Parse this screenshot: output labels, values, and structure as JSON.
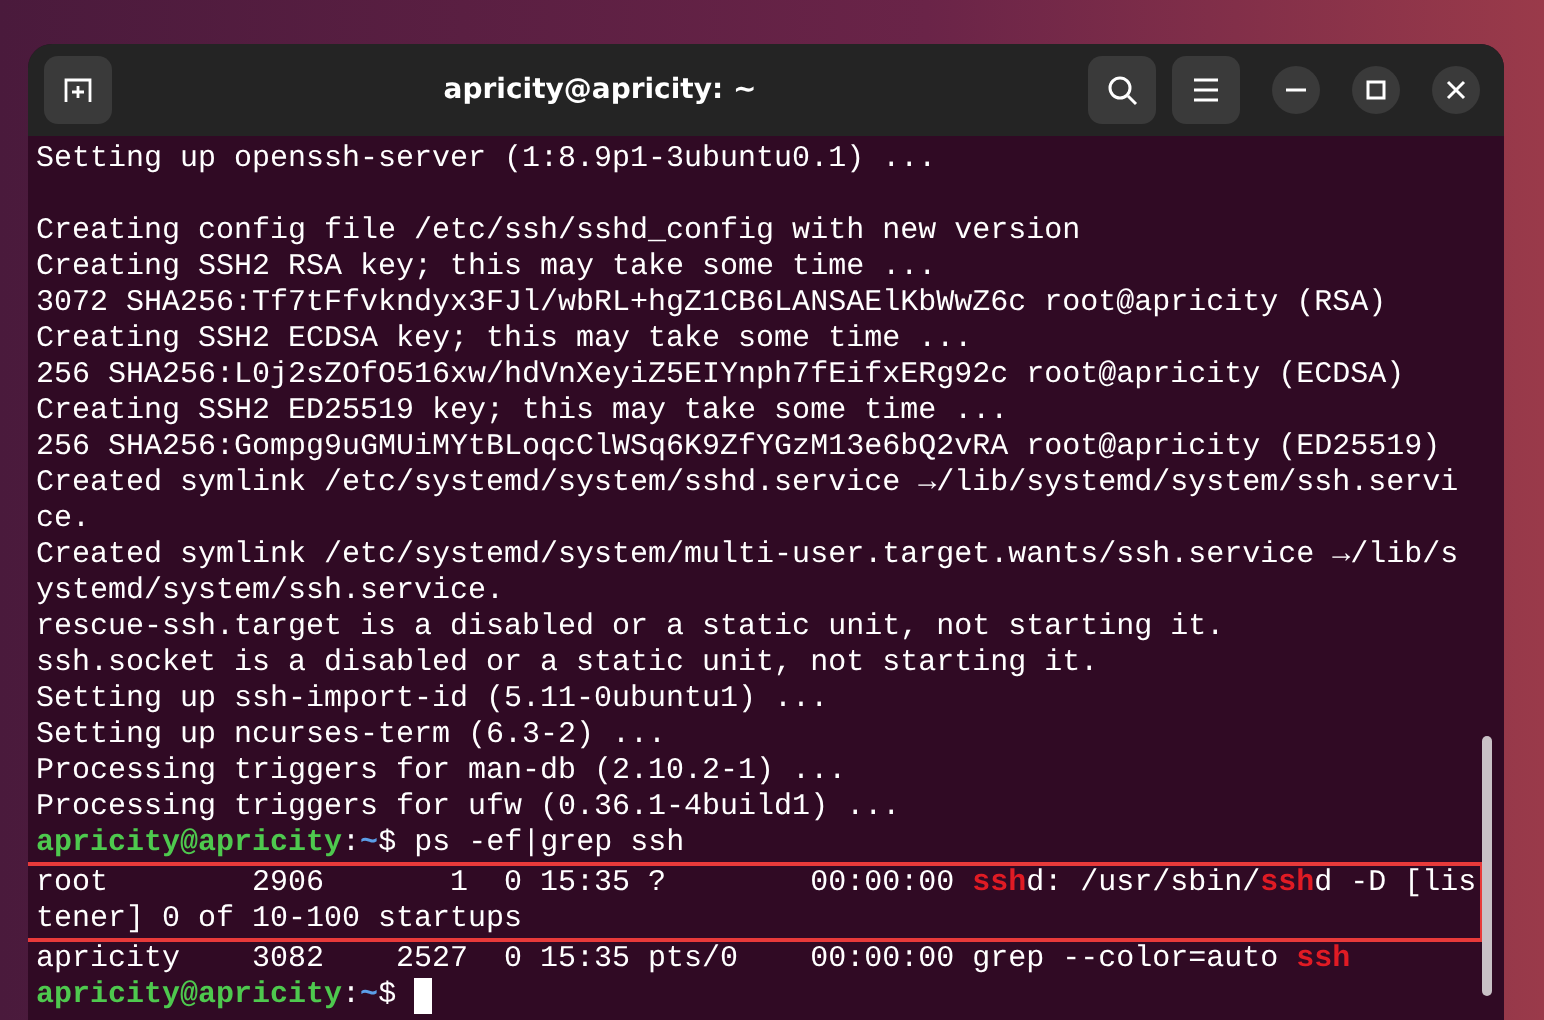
{
  "window": {
    "title": "apricity@apricity: ~"
  },
  "terminal": {
    "lines": [
      {
        "kind": "output",
        "highlighted": false,
        "segments": [
          {
            "kind": "plain",
            "text": "Setting up openssh-server (1:8.9p1-3ubuntu0.1) ..."
          }
        ]
      },
      {
        "kind": "blank",
        "highlighted": false
      },
      {
        "kind": "output",
        "highlighted": false,
        "segments": [
          {
            "kind": "plain",
            "text": "Creating config file /etc/ssh/sshd_config with new version"
          }
        ]
      },
      {
        "kind": "output",
        "highlighted": false,
        "segments": [
          {
            "kind": "plain",
            "text": "Creating SSH2 RSA key; this may take some time ..."
          }
        ]
      },
      {
        "kind": "output",
        "highlighted": false,
        "segments": [
          {
            "kind": "plain",
            "text": "3072 SHA256:Tf7tFfvkndyx3FJl/wbRL+hgZ1CB6LANSAElKbWwZ6c root@apricity (RSA)"
          }
        ]
      },
      {
        "kind": "output",
        "highlighted": false,
        "segments": [
          {
            "kind": "plain",
            "text": "Creating SSH2 ECDSA key; this may take some time ..."
          }
        ]
      },
      {
        "kind": "output",
        "highlighted": false,
        "segments": [
          {
            "kind": "plain",
            "text": "256 SHA256:L0j2sZOfO516xw/hdVnXeyiZ5EIYnph7fEifxERg92c root@apricity (ECDSA)"
          }
        ]
      },
      {
        "kind": "output",
        "highlighted": false,
        "segments": [
          {
            "kind": "plain",
            "text": "Creating SSH2 ED25519 key; this may take some time ..."
          }
        ]
      },
      {
        "kind": "output",
        "highlighted": false,
        "segments": [
          {
            "kind": "plain",
            "text": "256 SHA256:Gompg9uGMUiMYtBLoqcClWSq6K9ZfYGzM13e6bQ2vRA root@apricity (ED25519)"
          }
        ]
      },
      {
        "kind": "output",
        "highlighted": false,
        "segments": [
          {
            "kind": "plain",
            "text": "Created symlink /etc/systemd/system/sshd.service →/lib/systemd/system/ssh.servi"
          }
        ]
      },
      {
        "kind": "output",
        "highlighted": false,
        "segments": [
          {
            "kind": "plain",
            "text": "ce."
          }
        ]
      },
      {
        "kind": "output",
        "highlighted": false,
        "segments": [
          {
            "kind": "plain",
            "text": "Created symlink /etc/systemd/system/multi-user.target.wants/ssh.service →/lib/s"
          }
        ]
      },
      {
        "kind": "output",
        "highlighted": false,
        "segments": [
          {
            "kind": "plain",
            "text": "ystemd/system/ssh.service."
          }
        ]
      },
      {
        "kind": "output",
        "highlighted": false,
        "segments": [
          {
            "kind": "plain",
            "text": "rescue-ssh.target is a disabled or a static unit, not starting it."
          }
        ]
      },
      {
        "kind": "output",
        "highlighted": false,
        "segments": [
          {
            "kind": "plain",
            "text": "ssh.socket is a disabled or a static unit, not starting it."
          }
        ]
      },
      {
        "kind": "output",
        "highlighted": false,
        "segments": [
          {
            "kind": "plain",
            "text": "Setting up ssh-import-id (5.11-0ubuntu1) ..."
          }
        ]
      },
      {
        "kind": "output",
        "highlighted": false,
        "segments": [
          {
            "kind": "plain",
            "text": "Setting up ncurses-term (6.3-2) ..."
          }
        ]
      },
      {
        "kind": "output",
        "highlighted": false,
        "segments": [
          {
            "kind": "plain",
            "text": "Processing triggers for man-db (2.10.2-1) ..."
          }
        ]
      },
      {
        "kind": "output",
        "highlighted": false,
        "segments": [
          {
            "kind": "plain",
            "text": "Processing triggers for ufw (0.36.1-4build1) ..."
          }
        ]
      },
      {
        "kind": "prompt",
        "highlighted": false,
        "user": "apricity@apricity",
        "separator": ":",
        "path": "~",
        "symbol": "$",
        "command": "ps -ef|grep ssh",
        "cursor": false
      },
      {
        "kind": "output",
        "highlighted": true,
        "segments": [
          {
            "kind": "plain",
            "text": "root        2906       1  0 15:35 ?        00:00:00 "
          },
          {
            "kind": "match",
            "text": "ssh"
          },
          {
            "kind": "plain",
            "text": "d: /usr/sbin/"
          },
          {
            "kind": "match",
            "text": "ssh"
          },
          {
            "kind": "plain",
            "text": "d -D [lis"
          }
        ]
      },
      {
        "kind": "output",
        "highlighted": true,
        "segments": [
          {
            "kind": "plain",
            "text": "tener] 0 of 10-100 startups"
          }
        ]
      },
      {
        "kind": "output",
        "highlighted": false,
        "segments": [
          {
            "kind": "plain",
            "text": "apricity    3082    2527  0 15:35 pts/0    00:00:00 grep --color=auto "
          },
          {
            "kind": "match",
            "text": "ssh"
          }
        ]
      },
      {
        "kind": "prompt",
        "highlighted": false,
        "user": "apricity@apricity",
        "separator": ":",
        "path": "~",
        "symbol": "$",
        "cursor": true
      }
    ]
  }
}
